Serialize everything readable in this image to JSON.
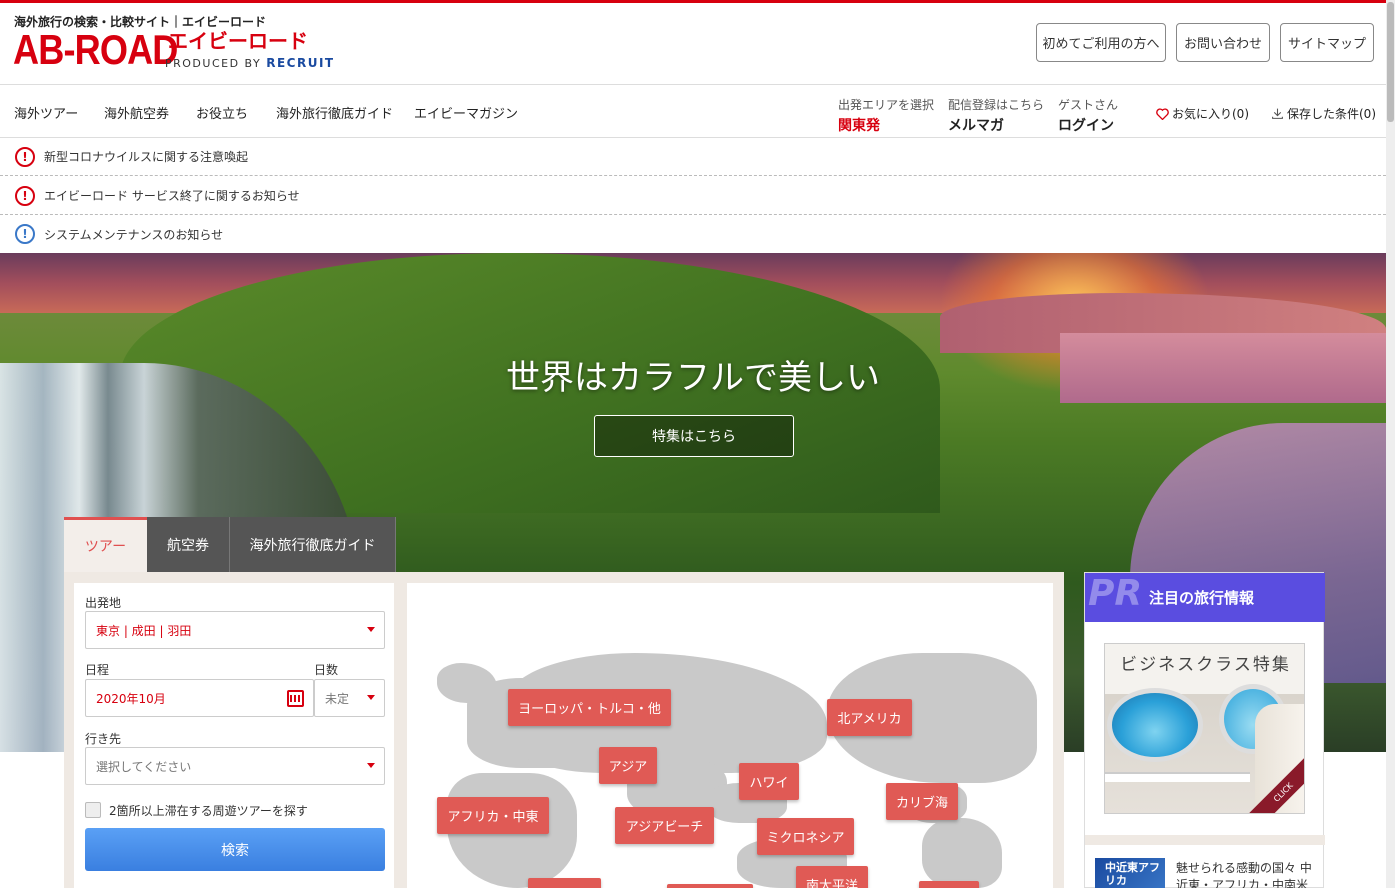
{
  "header": {
    "tagline": "海外旅行の検索・比較サイト｜エイビーロード",
    "logo_main": "AB-ROAD",
    "logo_kana": "エイビーロード",
    "logo_produced": "PRODUCED BY",
    "logo_recruit": "RECRUIT",
    "buttons": [
      "初めてご利用の方へ",
      "お問い合わせ",
      "サイトマップ"
    ]
  },
  "nav": {
    "items": [
      "海外ツアー",
      "海外航空券",
      "お役立ち",
      "海外旅行徹底ガイド",
      "エイビーマガジン"
    ],
    "departure": {
      "small": "出発エリアを選択",
      "value": "関東発"
    },
    "mailmag": {
      "small": "配信登録はこちら",
      "value": "メルマガ"
    },
    "login": {
      "small": "ゲストさん",
      "value": "ログイン"
    },
    "favorites": "お気に入り(0)",
    "saved": "保存した条件(0)"
  },
  "notices": [
    {
      "text": "新型コロナウイルスに関する注意喚起",
      "icon": "alert-icon",
      "color": "#d7000f"
    },
    {
      "text": "エイビーロード サービス終了に関するお知らせ",
      "icon": "alert-icon",
      "color": "#d7000f"
    },
    {
      "text": "システムメンテナンスのお知らせ",
      "icon": "info-icon",
      "color": "#3a78c8"
    }
  ],
  "hero": {
    "title": "世界はカラフルで美しい",
    "button": "特集はこちら"
  },
  "search": {
    "tabs": [
      "ツアー",
      "航空券",
      "海外旅行徹底ガイド"
    ],
    "departure_label": "出発地",
    "departure_value": "東京 | 成田 | 羽田",
    "date_label": "日程",
    "date_value": "2020年10月",
    "days_label": "日数",
    "days_value": "未定",
    "dest_label": "行き先",
    "dest_placeholder": "選択してください",
    "roundtrip_label": "2箇所以上滞在する周遊ツアーを探す",
    "search_button": "検索"
  },
  "map": {
    "regions": [
      "ヨーロッパ・トルコ・他",
      "北アメリカ",
      "アジア",
      "ハワイ",
      "カリブ海",
      "アフリカ・中東",
      "アジアビーチ",
      "ミクロネシア",
      "南太平洋"
    ]
  },
  "pr": {
    "badge": "PR",
    "title": "注目の旅行情報",
    "banner_title": "ビジネスクラス特集",
    "banner_click": "CLICK",
    "item_icon_text": "中近東アフリカ",
    "item_line1": "魅せられる感動の国々 中",
    "item_line2": "近東・アフリカ・中南米"
  },
  "colors": {
    "brand_red": "#d7000f",
    "accent_blue": "#3a7fe0",
    "pr_purple": "#5a4de0",
    "region_red": "#e05a55"
  }
}
